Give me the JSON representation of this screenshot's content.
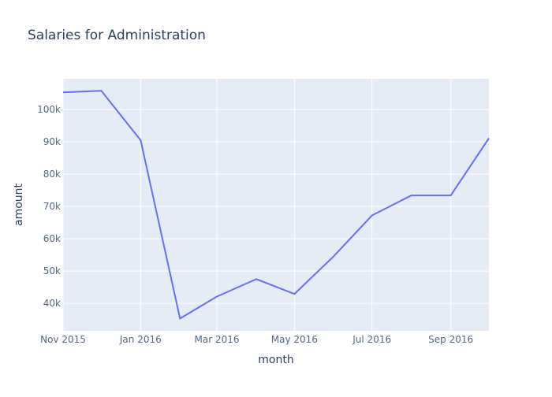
{
  "chart_data": {
    "type": "line",
    "title": "Salaries for Administration",
    "xlabel": "month",
    "ylabel": "amount",
    "x": [
      "2015-11-01",
      "2015-12-01",
      "2016-01-01",
      "2016-02-01",
      "2016-03-01",
      "2016-04-01",
      "2016-05-01",
      "2016-06-01",
      "2016-07-01",
      "2016-08-01",
      "2016-09-01",
      "2016-10-01"
    ],
    "series": [
      {
        "values": [
          105300,
          105800,
          90500,
          35300,
          42100,
          47500,
          42900,
          54600,
          67200,
          73400,
          73400,
          91100
        ]
      }
    ],
    "xlim": [
      "2015-11-01",
      "2016-10-01"
    ],
    "ylim": [
      31500,
      109500
    ],
    "x_ticks": [
      {
        "date": "2015-11-01",
        "label": "Nov 2015"
      },
      {
        "date": "2016-01-01",
        "label": "Jan 2016"
      },
      {
        "date": "2016-03-01",
        "label": "Mar 2016"
      },
      {
        "date": "2016-05-01",
        "label": "May 2016"
      },
      {
        "date": "2016-07-01",
        "label": "Jul 2016"
      },
      {
        "date": "2016-09-01",
        "label": "Sep 2016"
      }
    ],
    "y_ticks": [
      {
        "value": 40000,
        "label": "40k"
      },
      {
        "value": 50000,
        "label": "50k"
      },
      {
        "value": 60000,
        "label": "60k"
      },
      {
        "value": 70000,
        "label": "70k"
      },
      {
        "value": 80000,
        "label": "80k"
      },
      {
        "value": 90000,
        "label": "90k"
      },
      {
        "value": 100000,
        "label": "100k"
      }
    ],
    "grid": true,
    "colors": {
      "line": "#636efa",
      "plot_bg": "#e5ecf6",
      "grid": "#ffffff",
      "text": "#2a3f5f",
      "tick_text": "#506784"
    }
  }
}
